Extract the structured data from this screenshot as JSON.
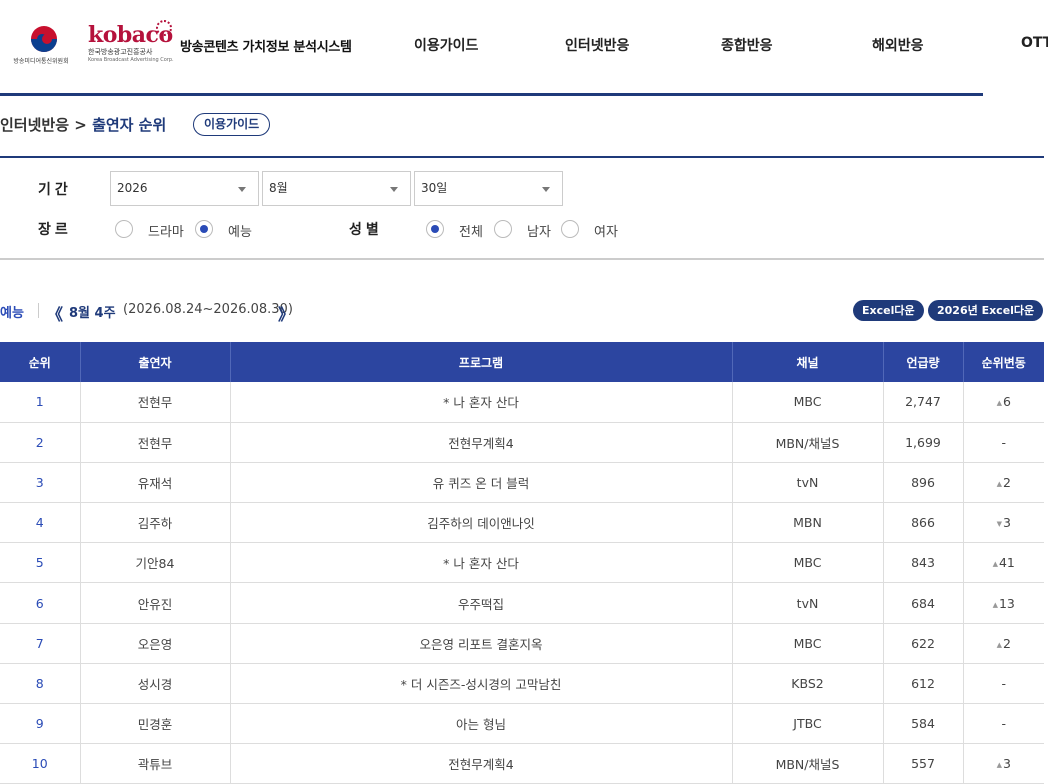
{
  "header": {
    "emblem_text": "방송미디어통신위원회",
    "kobaco_word": "kobaco",
    "kobaco_sub": "한국방송광고진흥공사",
    "kobaco_sub_en": "Korea Broadcast Advertising Corp.",
    "site_title": "방송콘텐츠 가치정보 분석시스템",
    "nav": [
      "이용가이드",
      "인터넷반응",
      "종합반응",
      "해외반응",
      "OTT"
    ]
  },
  "breadcrumb": {
    "parent": "인터넷반응",
    "separator": ">",
    "current": "출연자 순위",
    "guide_button": "이용가이드"
  },
  "filters": {
    "period_label": "기간",
    "year": "2026",
    "month": "8월",
    "day": "30일",
    "genre_label": "장르",
    "genre_options": [
      "드라마",
      "예능"
    ],
    "genre_selected": "예능",
    "gender_label": "성별",
    "gender_options": [
      "전체",
      "남자",
      "여자"
    ],
    "gender_selected": "전체"
  },
  "week": {
    "genre": "예능",
    "prev_arrow": "《",
    "label": "8월 4주",
    "range": "(2026.08.24~2026.08.30)",
    "next_arrow": "》",
    "excel_button": "Excel다운",
    "year_excel_button": "2026년 Excel다운"
  },
  "table": {
    "headers": [
      "순위",
      "출연자",
      "프로그램",
      "채널",
      "언급량",
      "순위변동"
    ],
    "rows": [
      {
        "rank": "1",
        "performer": "전현무",
        "program": "* 나 혼자 산다",
        "channel": "MBC",
        "mentions": "2,747",
        "change": "6",
        "dir": "up"
      },
      {
        "rank": "2",
        "performer": "전현무",
        "program": "전현무계획4",
        "channel": "MBN/채널S",
        "mentions": "1,699",
        "change": "-",
        "dir": "none"
      },
      {
        "rank": "3",
        "performer": "유재석",
        "program": "유 퀴즈 온 더 블럭",
        "channel": "tvN",
        "mentions": "896",
        "change": "2",
        "dir": "up"
      },
      {
        "rank": "4",
        "performer": "김주하",
        "program": "김주하의 데이앤나잇",
        "channel": "MBN",
        "mentions": "866",
        "change": "3",
        "dir": "down"
      },
      {
        "rank": "5",
        "performer": "기안84",
        "program": "* 나 혼자 산다",
        "channel": "MBC",
        "mentions": "843",
        "change": "41",
        "dir": "up"
      },
      {
        "rank": "6",
        "performer": "안유진",
        "program": "우주떡집",
        "channel": "tvN",
        "mentions": "684",
        "change": "13",
        "dir": "up"
      },
      {
        "rank": "7",
        "performer": "오은영",
        "program": "오은영 리포트 결혼지옥",
        "channel": "MBC",
        "mentions": "622",
        "change": "2",
        "dir": "up"
      },
      {
        "rank": "8",
        "performer": "성시경",
        "program": "* 더 시즌즈-성시경의 고막남친",
        "channel": "KBS2",
        "mentions": "612",
        "change": "-",
        "dir": "none"
      },
      {
        "rank": "9",
        "performer": "민경훈",
        "program": "아는 형님",
        "channel": "JTBC",
        "mentions": "584",
        "change": "-",
        "dir": "none"
      },
      {
        "rank": "10",
        "performer": "곽튜브",
        "program": "전현무계획4",
        "channel": "MBN/채널S",
        "mentions": "557",
        "change": "3",
        "dir": "up"
      }
    ]
  }
}
